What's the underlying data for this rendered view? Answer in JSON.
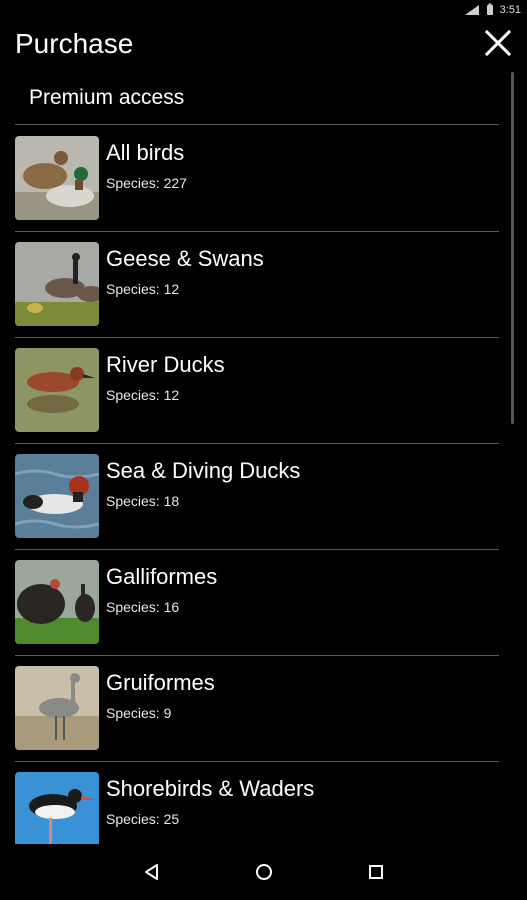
{
  "status": {
    "time": "3:51"
  },
  "header": {
    "title": "Purchase"
  },
  "section_title": "Premium access",
  "items": [
    {
      "title": "All birds",
      "subtitle": "Species: 227"
    },
    {
      "title": "Geese & Swans",
      "subtitle": "Species: 12"
    },
    {
      "title": "River Ducks",
      "subtitle": "Species: 12"
    },
    {
      "title": "Sea & Diving Ducks",
      "subtitle": "Species: 18"
    },
    {
      "title": "Galliformes",
      "subtitle": "Species: 16"
    },
    {
      "title": "Gruiformes",
      "subtitle": "Species: 9"
    },
    {
      "title": "Shorebirds & Waders",
      "subtitle": "Species: 25"
    }
  ],
  "icons": {
    "close": "close-icon",
    "back": "back-icon",
    "home": "home-icon",
    "recents": "recents-icon",
    "signal": "signal-icon",
    "battery": "battery-icon"
  }
}
